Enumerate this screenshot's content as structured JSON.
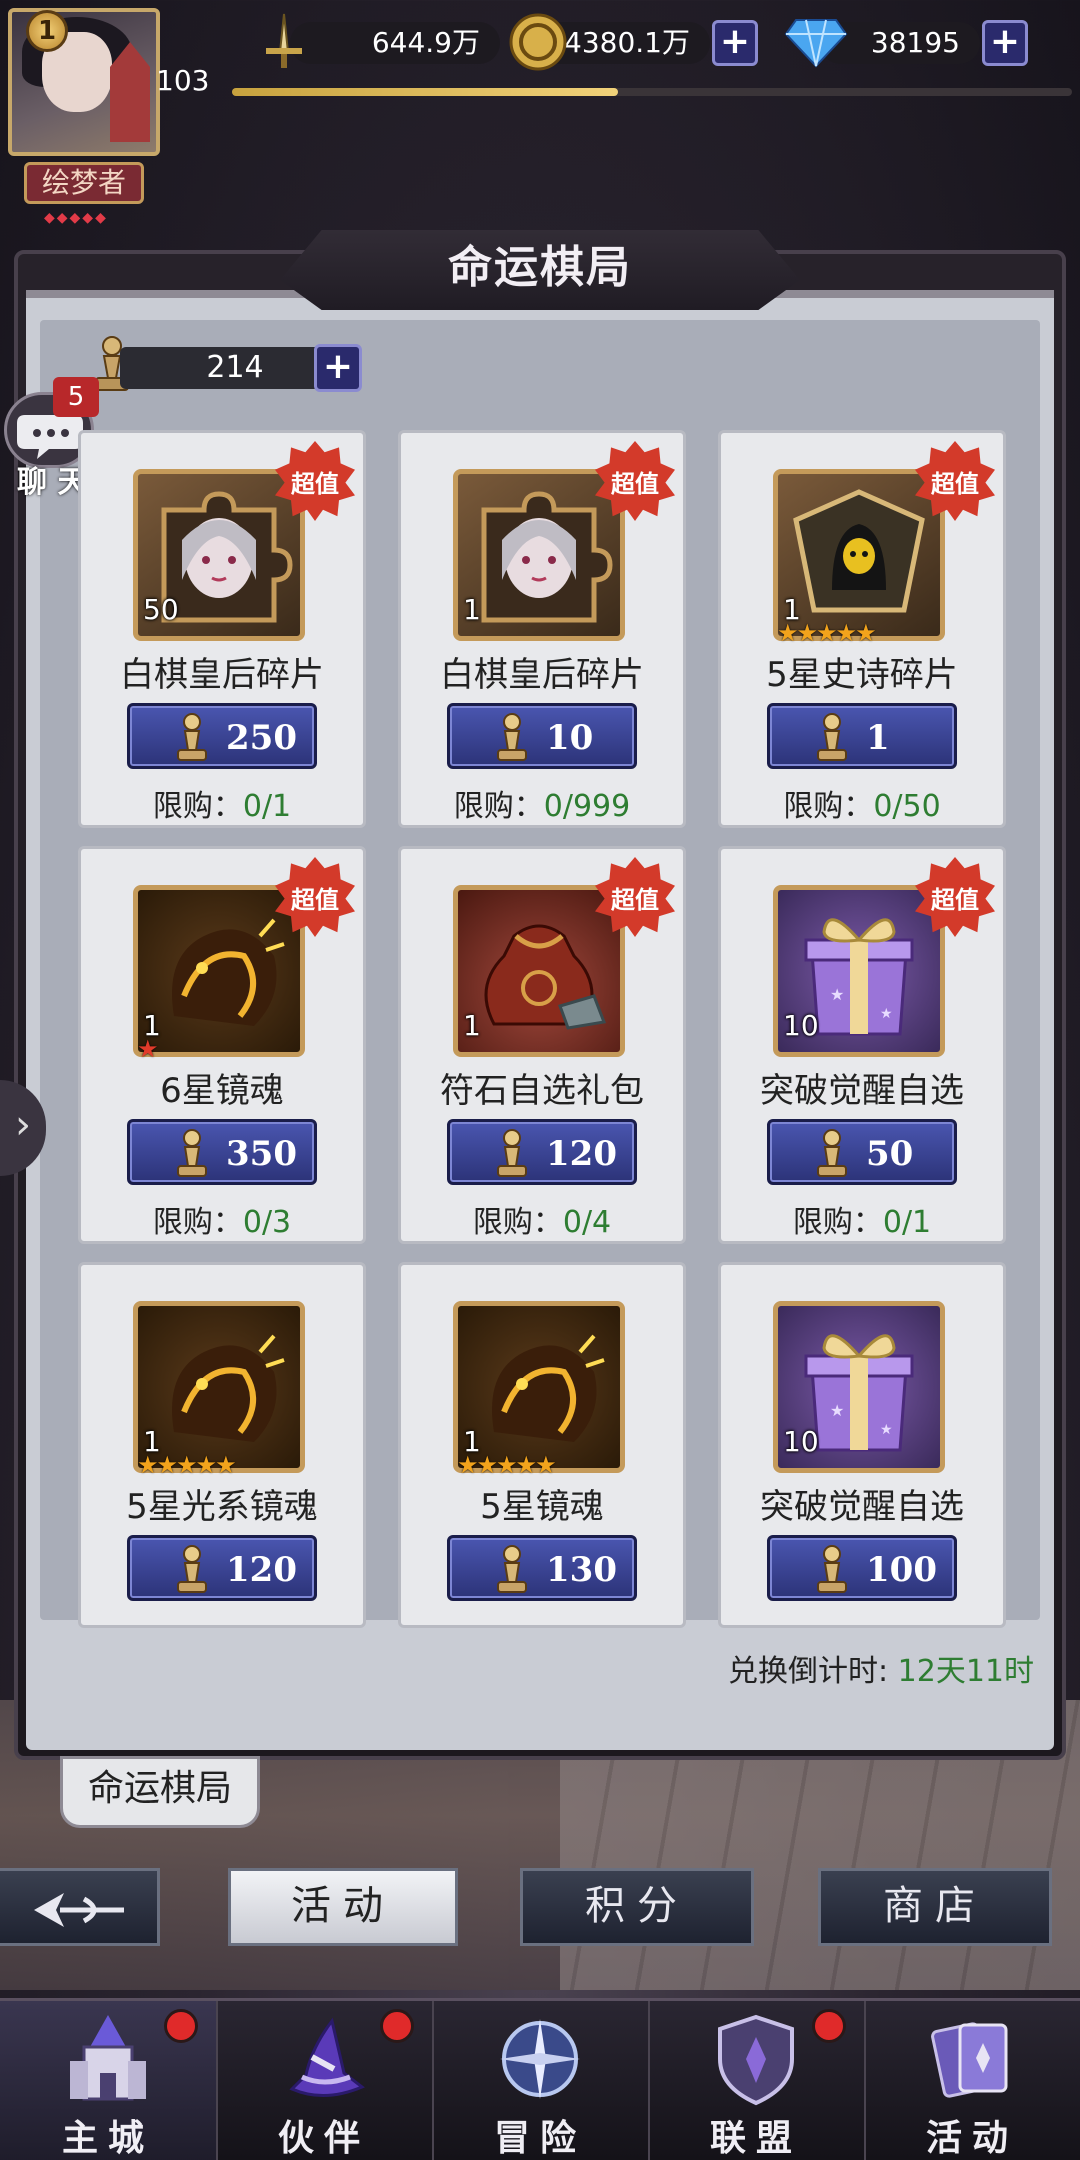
{
  "player": {
    "level": "1",
    "power": "103",
    "xp_fraction": 0.46,
    "title": "绘梦者"
  },
  "resources": {
    "sword": "644.9万",
    "gold": "4380.1万",
    "diamond": "38195"
  },
  "panel": {
    "title": "命运棋局",
    "tab_tag": "命运棋局"
  },
  "token": {
    "count": "214"
  },
  "chat": {
    "badge": "5",
    "label": "聊 天"
  },
  "limit_label": "限购：",
  "badge_text": "超值",
  "items": [
    {
      "name": "白棋皇后碎片",
      "qty": "50",
      "price": "250",
      "limit": "0/1",
      "badge": true,
      "stars": 0,
      "star_color": "gold",
      "icon": "queen-shard-icon"
    },
    {
      "name": "白棋皇后碎片",
      "qty": "1",
      "price": "10",
      "limit": "0/999",
      "badge": true,
      "stars": 0,
      "star_color": "gold",
      "icon": "queen-shard-icon"
    },
    {
      "name": "5星史诗碎片",
      "qty": "1",
      "price": "1",
      "limit": "0/50",
      "badge": true,
      "stars": 5,
      "star_color": "gold",
      "icon": "epic-shard-icon"
    },
    {
      "name": "6星镜魂",
      "qty": "1",
      "price": "350",
      "limit": "0/3",
      "badge": true,
      "stars": 1,
      "star_color": "red",
      "icon": "mirror-soul-icon"
    },
    {
      "name": "符石自选礼包",
      "qty": "1",
      "price": "120",
      "limit": "0/4",
      "badge": true,
      "stars": 0,
      "star_color": "gold",
      "icon": "rune-bag-icon"
    },
    {
      "name": "突破觉醒自选",
      "qty": "10",
      "price": "50",
      "limit": "0/1",
      "badge": true,
      "stars": 0,
      "star_color": "gold",
      "icon": "gift-box-icon"
    },
    {
      "name": "5星光系镜魂",
      "qty": "1",
      "price": "120",
      "limit": "",
      "badge": false,
      "stars": 5,
      "star_color": "gold",
      "icon": "mirror-soul-icon"
    },
    {
      "name": "5星镜魂",
      "qty": "1",
      "price": "130",
      "limit": "",
      "badge": false,
      "stars": 5,
      "star_color": "gold",
      "icon": "mirror-soul-icon"
    },
    {
      "name": "突破觉醒自选",
      "qty": "10",
      "price": "100",
      "limit": "",
      "badge": false,
      "stars": 0,
      "star_color": "gold",
      "icon": "gift-box-icon"
    }
  ],
  "countdown": {
    "label": "兑换倒计时: ",
    "value": "12天11时"
  },
  "subtabs": {
    "activity": "活动",
    "points": "积分",
    "shop": "商店"
  },
  "nav": [
    {
      "label": "主城",
      "dot": true,
      "active": true,
      "icon": "castle-icon"
    },
    {
      "label": "伙伴",
      "dot": true,
      "active": false,
      "icon": "witch-hat-icon"
    },
    {
      "label": "冒险",
      "dot": false,
      "active": false,
      "icon": "compass-icon"
    },
    {
      "label": "联盟",
      "dot": true,
      "active": false,
      "icon": "shield-icon"
    },
    {
      "label": "活动",
      "dot": false,
      "active": false,
      "icon": "cards-icon"
    }
  ]
}
